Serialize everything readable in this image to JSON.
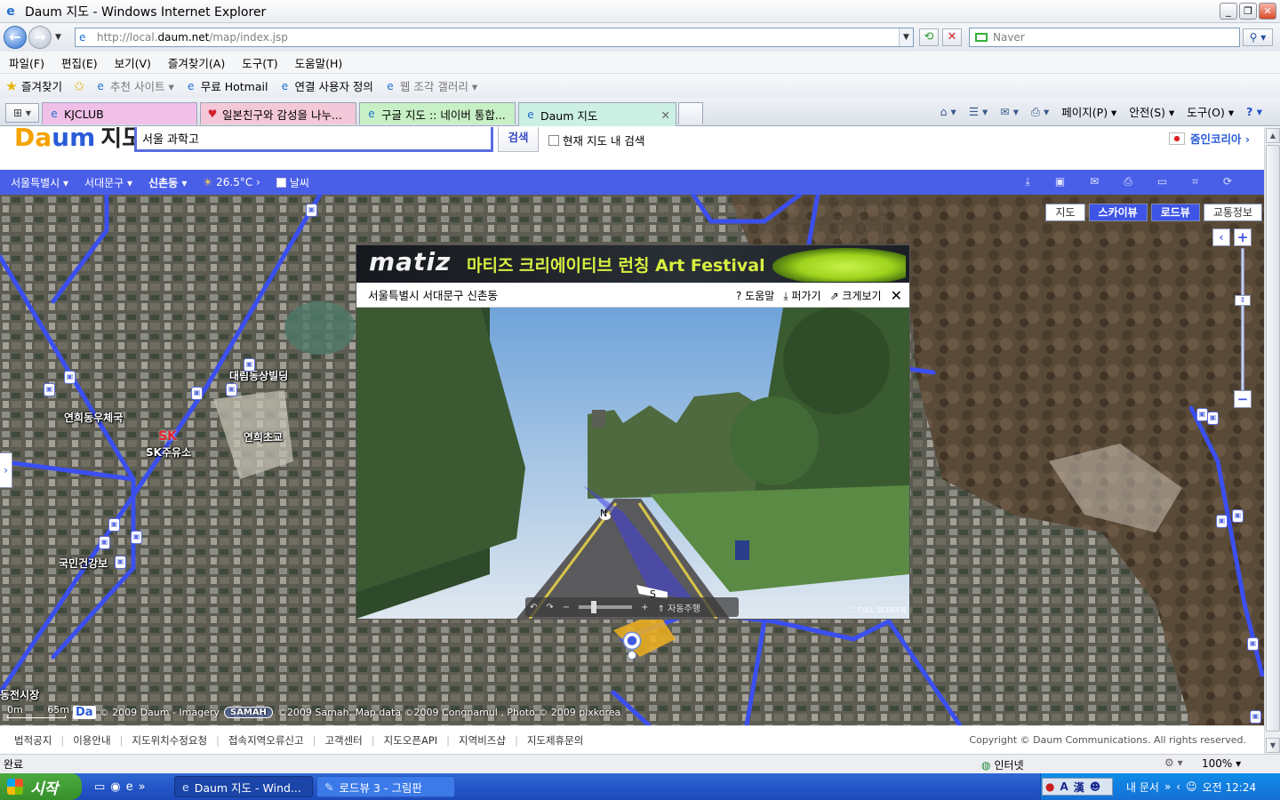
{
  "window": {
    "title": "Daum 지도 - Windows Internet Explorer",
    "minimize": "_",
    "restore": "❐",
    "close": "✕"
  },
  "address": {
    "prefix": "http://local.",
    "domain": "daum.net",
    "path": "/map/index.jsp",
    "search_placeholder": "Naver"
  },
  "menu": [
    "파일(F)",
    "편집(E)",
    "보기(V)",
    "즐겨찾기(A)",
    "도구(T)",
    "도움말(H)"
  ],
  "favorites": {
    "label": "즐겨찾기",
    "items": [
      {
        "label": "추천 사이트 ▾",
        "dim": true
      },
      {
        "label": "무료 Hotmail",
        "dim": false
      },
      {
        "label": "연결 사용자 정의",
        "dim": false
      },
      {
        "label": "웹 조각 갤러리 ▾",
        "dim": true
      }
    ]
  },
  "tabs": [
    {
      "label": "KJCLUB"
    },
    {
      "label": "일본친구와 감성을 나누..."
    },
    {
      "label": "구글 지도 :: 네이버 통합..."
    },
    {
      "label": "Daum 지도"
    }
  ],
  "commands": [
    "페이지(P) ▾",
    "안전(S) ▾",
    "도구(O) ▾"
  ],
  "daum": {
    "logo_d": "Da",
    "logo_m": "um",
    "logo_text": "지도",
    "search_value": "서울 과학고",
    "search_button": "검색",
    "in_map_search": "현재 지도 내 검색",
    "korea_link": "줌인코리아 ›"
  },
  "location_bar": {
    "city": "서울특별시 ▾",
    "district": "서대문구 ▾",
    "dong": "신촌동 ▾",
    "temperature": "26.5°C ›",
    "weather_label": "날씨"
  },
  "map": {
    "types": [
      {
        "label": "지도",
        "active": false
      },
      {
        "label": "스카이뷰",
        "active": true
      },
      {
        "label": "로드뷰",
        "active": true
      },
      {
        "label": "교통정보",
        "active": false
      }
    ],
    "pois": [
      {
        "label": "대림동상빌딩"
      },
      {
        "label": "연희동우체국"
      },
      {
        "label": "연희초교"
      },
      {
        "label": "SK주유소"
      },
      {
        "label": "국민건강보"
      },
      {
        "label": "동전시장"
      }
    ],
    "scale": {
      "left": "0m",
      "right": "65m"
    },
    "copyright": "© 2009 Daum - Imagery",
    "samah": "SAMAH",
    "copyright_2": "©2009 Samah, Map data ©2009 Congnamul , Photo © 2009 pixkorea"
  },
  "roadview": {
    "ad_brand": "matiz",
    "ad_text": "마티즈 크리에이티브 런칭 Art Festival",
    "location": "서울특별시 서대문구 신촌동",
    "help": "? 도움말",
    "share": "⤓ 퍼가기",
    "enlarge": "⇗ 크게보기",
    "auto_drive": "⇑ 자동주행",
    "fullscreen": "FULL SCREEN",
    "compass_n": "N",
    "compass_s": "S"
  },
  "footer": {
    "links": [
      "법적공지",
      "이용안내",
      "지도위치수정요청",
      "접속지역오류신고",
      "고객센터",
      "지도오픈API",
      "지역비즈샵",
      "지도제휴문의"
    ],
    "copyright": "Copyright © Daum Communications. All rights reserved."
  },
  "status": {
    "text": "완료",
    "zone": "인터넷",
    "zoom": "100% ▾"
  },
  "taskbar": {
    "start": "시작",
    "tasks": [
      "Daum 지도 - Wind...",
      "로드뷰 3 - 그림판"
    ],
    "tray_docs": "내 문서",
    "clock": "오전 12:24"
  }
}
